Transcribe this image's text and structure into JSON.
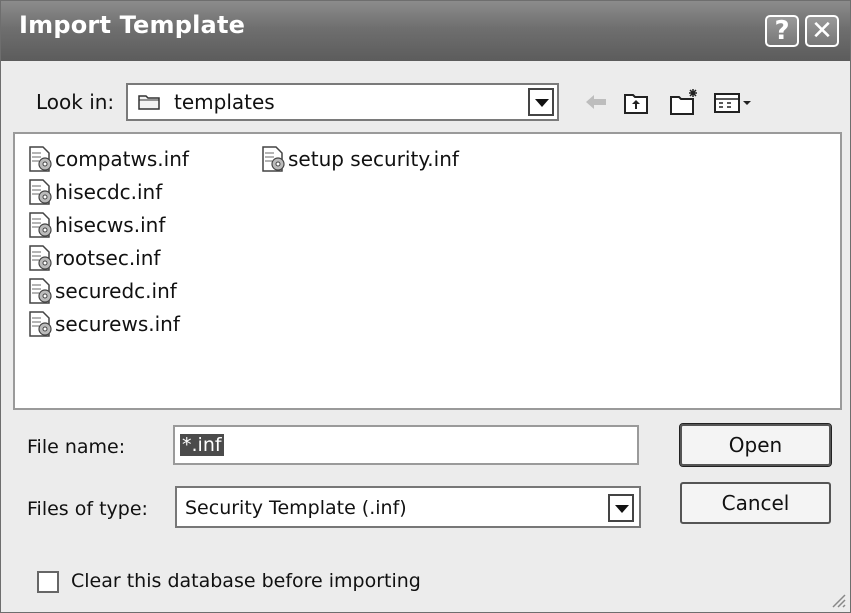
{
  "window": {
    "title": "Import Template",
    "help_glyph": "?",
    "close_glyph": "✕"
  },
  "lookin": {
    "label": "Look in:",
    "value": "templates",
    "icon": "folder-icon"
  },
  "toolbar": {
    "icons": [
      "back-arrow-icon",
      "up-folder-icon",
      "new-folder-icon",
      "views-menu-icon"
    ]
  },
  "files": [
    "compatws.inf",
    "hisecdc.inf",
    "hisecws.inf",
    "rootsec.inf",
    "securedc.inf",
    "securews.inf",
    "setup security.inf"
  ],
  "filename": {
    "label": "File name:",
    "value": "*.inf"
  },
  "filetype": {
    "label": "Files of type:",
    "value": "Security Template (.inf)"
  },
  "buttons": {
    "open": "Open",
    "cancel": "Cancel"
  },
  "option": {
    "label": "Clear this database before importing",
    "checked": false
  },
  "colors": {
    "titlebar": "#6f6f6f",
    "selection": "#4b4b4b"
  }
}
